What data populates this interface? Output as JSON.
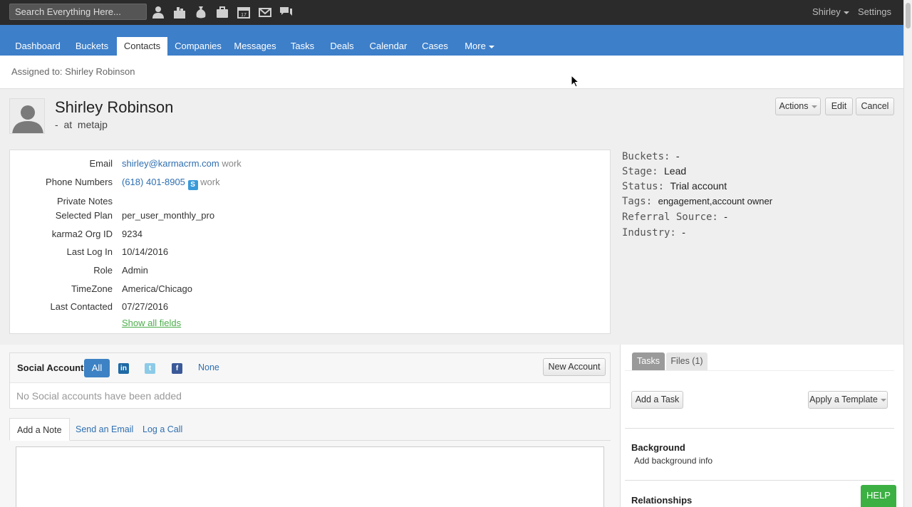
{
  "topbar": {
    "search_placeholder": "Search Everything Here...",
    "icons": [
      "contact-icon",
      "company-icon",
      "deal-icon",
      "case-icon",
      "calendar-icon",
      "mail-icon",
      "chat-icon"
    ],
    "user_label": "Shirley",
    "settings_label": "Settings"
  },
  "nav": {
    "tabs": [
      "Dashboard",
      "Buckets",
      "Contacts",
      "Companies",
      "Messages",
      "Tasks",
      "Deals",
      "Calendar",
      "Cases",
      "More"
    ],
    "active": "Contacts"
  },
  "assigned_to": "Assigned to: Shirley Robinson",
  "contact": {
    "name": "Shirley Robinson",
    "subtitle_dash": "-",
    "subtitle_at": "at",
    "company": "metajp"
  },
  "actions": {
    "actions_label": "Actions",
    "edit_label": "Edit",
    "cancel_label": "Cancel"
  },
  "fields": {
    "email_label": "Email",
    "email_value": "shirley@karmacrm.com",
    "email_type": "work",
    "phone_label": "Phone Numbers",
    "phone_value": "(618) 401-8905",
    "phone_type": "work",
    "private_notes_label": "Private Notes",
    "plan_label": "Selected Plan",
    "plan_value": "per_user_monthly_pro",
    "org_label": "karma2 Org ID",
    "org_value": "9234",
    "lastlog_label": "Last Log In",
    "lastlog_value": "10/14/2016",
    "role_label": "Role",
    "role_value": "Admin",
    "tz_label": "TimeZone",
    "tz_value": "America/Chicago",
    "lastcontact_label": "Last Contacted",
    "lastcontact_value": "07/27/2016",
    "show_all": "Show all fields"
  },
  "side": {
    "buckets_label": "Buckets:",
    "buckets_value": "-",
    "stage_label": "Stage:",
    "stage_value": "Lead",
    "status_label": "Status:",
    "status_value": "Trial account",
    "tags_label": "Tags:",
    "tags_value": "engagement,account owner",
    "referral_label": "Referral Source:",
    "referral_value": "-",
    "industry_label": "Industry:",
    "industry_value": "-"
  },
  "social": {
    "title": "Social Accounts",
    "all_label": "All",
    "none_label": "None",
    "new_account_label": "New Account",
    "empty_text": "No Social accounts have been added"
  },
  "note_tabs": [
    "Add a Note",
    "Send an Email",
    "Log a Call"
  ],
  "right": {
    "tasks_tab": "Tasks",
    "files_tab": "Files (1)",
    "add_task_label": "Add a Task",
    "apply_template_label": "Apply a Template",
    "background_title": "Background",
    "background_link": "Add background info",
    "relationships_title": "Relationships"
  },
  "help_label": "HELP",
  "colors": {
    "nav_blue": "#3d7fc9",
    "topbar": "#2b2b2b",
    "link_blue": "#2f6fb0",
    "help_green": "#3cb043"
  }
}
